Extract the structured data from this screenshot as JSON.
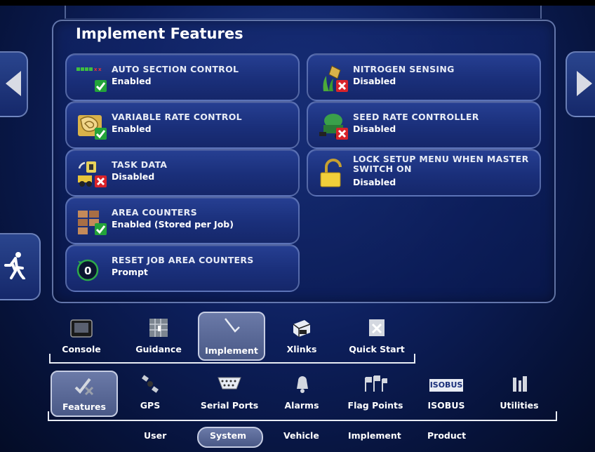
{
  "panel": {
    "title": "Implement Features"
  },
  "features_left": [
    {
      "name": "AUTO SECTION CONTROL",
      "value": "Enabled",
      "icon": "auto-section-icon",
      "status": "enabled"
    },
    {
      "name": "VARIABLE RATE CONTROL",
      "value": "Enabled",
      "icon": "variable-rate-map-icon",
      "status": "enabled"
    },
    {
      "name": "TASK DATA",
      "value": "Disabled",
      "icon": "task-data-icon",
      "status": "disabled"
    },
    {
      "name": "AREA COUNTERS",
      "value": "Enabled (Stored per Job)",
      "icon": "area-counters-icon",
      "status": "enabled"
    },
    {
      "name": "RESET JOB AREA COUNTERS",
      "value": "Prompt",
      "icon": "reset-counter-icon",
      "status": "none"
    }
  ],
  "features_right": [
    {
      "name": "NITROGEN SENSING",
      "value": "Disabled",
      "icon": "nitrogen-sensor-icon",
      "status": "disabled"
    },
    {
      "name": "SEED RATE CONTROLLER",
      "value": "Disabled",
      "icon": "seed-rate-icon",
      "status": "disabled"
    },
    {
      "name": "LOCK SETUP MENU WHEN MASTER SWITCH ON",
      "value": "Disabled",
      "icon": "padlock-icon",
      "status": "none"
    }
  ],
  "level1_tabs": [
    "Console",
    "Guidance",
    "Implement",
    "Xlinks",
    "Quick Start"
  ],
  "level1_selected": "Implement",
  "level2_tabs": [
    "Features",
    "GPS",
    "Serial Ports",
    "Alarms",
    "Flag Points",
    "ISOBUS",
    "Utilities"
  ],
  "level2_selected": "Features",
  "level3_tabs": [
    "User",
    "System",
    "Vehicle",
    "Implement",
    "Product"
  ],
  "level3_selected": "System",
  "isobus_logo_text": "ISOBUS",
  "colors": {
    "enabled": "#23a33a",
    "disabled": "#d8232a",
    "background": "#0d1f5c"
  }
}
